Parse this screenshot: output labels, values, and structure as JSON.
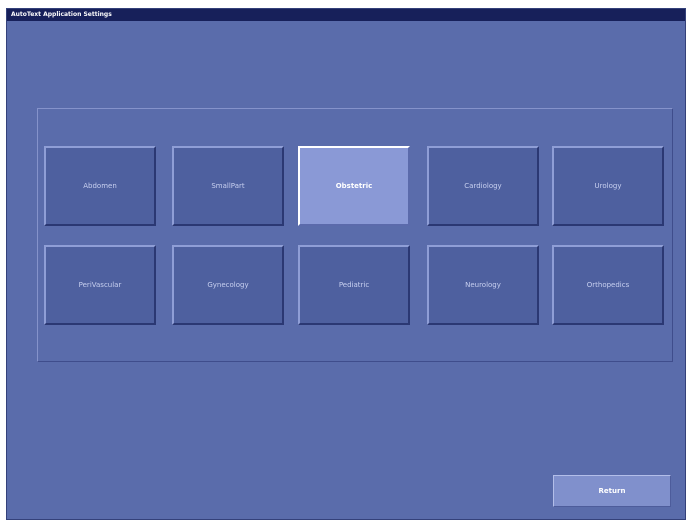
{
  "window": {
    "title": "AutoText Application Settings"
  },
  "applications": [
    {
      "label": "Abdomen",
      "selected": false
    },
    {
      "label": "SmallPart",
      "selected": false
    },
    {
      "label": "Obstetric",
      "selected": true
    },
    {
      "label": "Cardiology",
      "selected": false
    },
    {
      "label": "Urology",
      "selected": false
    },
    {
      "label": "PeriVascular",
      "selected": false
    },
    {
      "label": "Gynecology",
      "selected": false
    },
    {
      "label": "Pediatric",
      "selected": false
    },
    {
      "label": "Neurology",
      "selected": false
    },
    {
      "label": "Orthopedics",
      "selected": false
    }
  ],
  "footer": {
    "return_label": "Return"
  },
  "colors": {
    "background": "#5a6cab",
    "titlebar": "#17205a",
    "selected_button": "#8a99d6",
    "return_button": "#8090cc"
  }
}
